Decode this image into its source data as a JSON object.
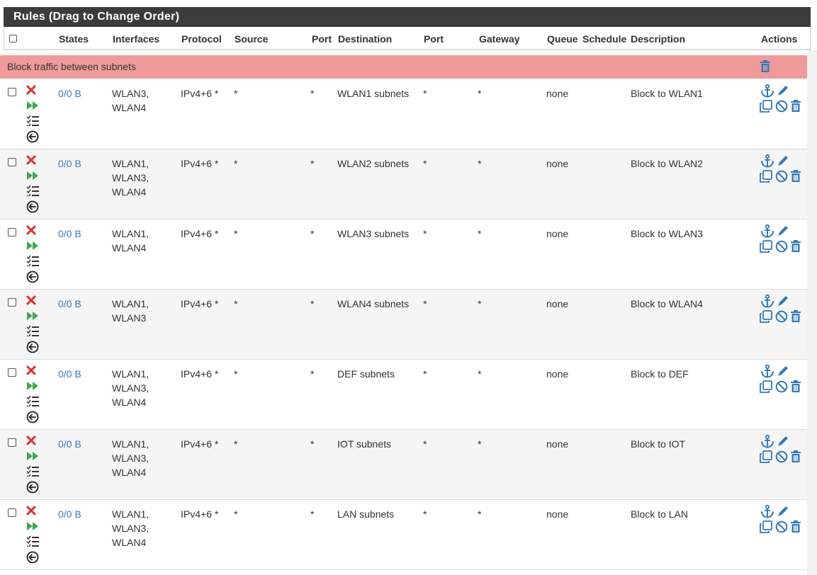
{
  "panel": {
    "title": "Rules (Drag to Change Order)"
  },
  "columns": {
    "states": "States",
    "interfaces": "Interfaces",
    "protocol": "Protocol",
    "source": "Source",
    "source_port": "Port",
    "destination": "Destination",
    "dest_port": "Port",
    "gateway": "Gateway",
    "queue": "Queue",
    "schedule": "Schedule",
    "description": "Description",
    "actions": "Actions"
  },
  "separator": {
    "label": "Block traffic between subnets",
    "color": "#ef9a9a"
  },
  "colors": {
    "link": "#337ab7",
    "block": "#d9302c",
    "pass": "#3ea84f",
    "header_bg": "#3c3c3c",
    "alt_row": "#f5f5f5"
  },
  "icons": {
    "rule_type": "block-x-icon",
    "quick": "fast-forward-icon",
    "log": "log-list-icon",
    "direction": "direction-in-icon",
    "anchor": "anchor-icon",
    "edit": "pencil-icon",
    "copy": "copy-icon",
    "disable": "disable-icon",
    "delete": "trash-icon"
  },
  "rows": [
    {
      "states": "0/0 B",
      "interfaces": [
        "WLAN3,",
        "WLAN4"
      ],
      "protocol": "IPv4+6 *",
      "source": "*",
      "source_port": "*",
      "destination": "WLAN1 subnets",
      "dest_port": "*",
      "gateway": "*",
      "queue": "none",
      "schedule": "",
      "description": "Block to WLAN1"
    },
    {
      "states": "0/0 B",
      "interfaces": [
        "WLAN1,",
        "WLAN3,",
        "WLAN4"
      ],
      "protocol": "IPv4+6 *",
      "source": "*",
      "source_port": "*",
      "destination": "WLAN2 subnets",
      "dest_port": "*",
      "gateway": "*",
      "queue": "none",
      "schedule": "",
      "description": "Block to WLAN2"
    },
    {
      "states": "0/0 B",
      "interfaces": [
        "WLAN1,",
        "WLAN4"
      ],
      "protocol": "IPv4+6 *",
      "source": "*",
      "source_port": "*",
      "destination": "WLAN3 subnets",
      "dest_port": "*",
      "gateway": "*",
      "queue": "none",
      "schedule": "",
      "description": "Block to WLAN3"
    },
    {
      "states": "0/0 B",
      "interfaces": [
        "WLAN1,",
        "WLAN3"
      ],
      "protocol": "IPv4+6 *",
      "source": "*",
      "source_port": "*",
      "destination": "WLAN4 subnets",
      "dest_port": "*",
      "gateway": "*",
      "queue": "none",
      "schedule": "",
      "description": "Block to WLAN4"
    },
    {
      "states": "0/0 B",
      "interfaces": [
        "WLAN1,",
        "WLAN3,",
        "WLAN4"
      ],
      "protocol": "IPv4+6 *",
      "source": "*",
      "source_port": "*",
      "destination": "DEF subnets",
      "dest_port": "*",
      "gateway": "*",
      "queue": "none",
      "schedule": "",
      "description": "Block to DEF"
    },
    {
      "states": "0/0 B",
      "interfaces": [
        "WLAN1,",
        "WLAN3,",
        "WLAN4"
      ],
      "protocol": "IPv4+6 *",
      "source": "*",
      "source_port": "*",
      "destination": "IOT subnets",
      "dest_port": "*",
      "gateway": "*",
      "queue": "none",
      "schedule": "",
      "description": "Block to IOT"
    },
    {
      "states": "0/0 B",
      "interfaces": [
        "WLAN1,",
        "WLAN3,",
        "WLAN4"
      ],
      "protocol": "IPv4+6 *",
      "source": "*",
      "source_port": "*",
      "destination": "LAN subnets",
      "dest_port": "*",
      "gateway": "*",
      "queue": "none",
      "schedule": "",
      "description": "Block to LAN"
    }
  ]
}
